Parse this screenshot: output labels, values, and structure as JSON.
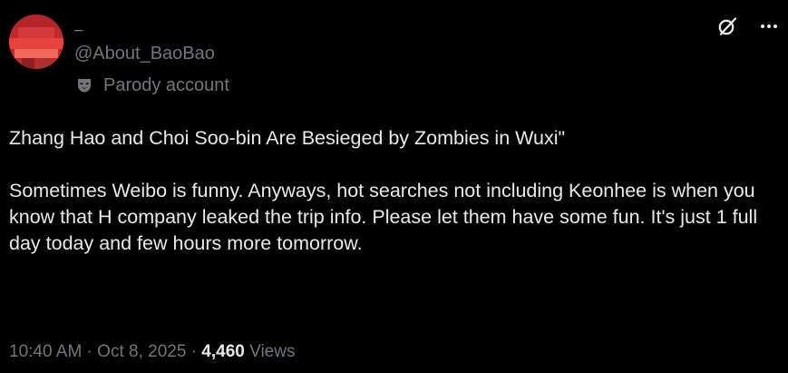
{
  "user": {
    "display_name": "_",
    "handle": "@About_BaoBao",
    "badge_label": "Parody account",
    "badge_icon": "theater-mask-icon"
  },
  "actions": {
    "grok_icon": "grok-icon",
    "more_icon": "more-dots-icon"
  },
  "tweet": {
    "text": "Zhang Hao and Choi Soo-bin Are Besieged by Zombies in Wuxi\"\n\nSometimes Weibo is funny. Anyways, hot searches not including Keonhee is when you know that H company leaked the trip info. Please let them have some fun. It's just 1 full day today and few hours more tomorrow."
  },
  "meta": {
    "time": "10:40 AM",
    "separator": " · ",
    "date": "Oct 8, 2025",
    "views_count": "4,460",
    "views_label": "Views"
  },
  "colors": {
    "background": "#000000",
    "text_primary": "#e7e9ea",
    "text_secondary": "#71767b",
    "avatar_red": "#c1282b"
  }
}
